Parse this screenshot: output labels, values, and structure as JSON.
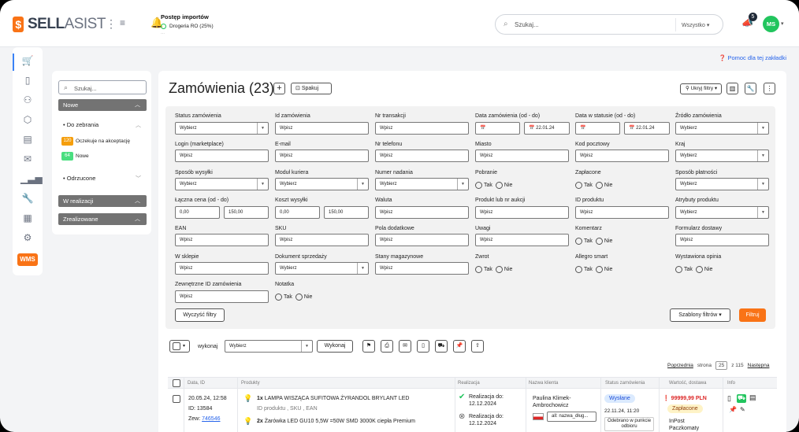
{
  "header": {
    "brand_bold": "SELL",
    "brand_light": "ASIST",
    "import_title": "Postęp importów",
    "import_row": "Drogeria RO (25%)",
    "import_row2": "...",
    "search_placeholder": "Szukaj...",
    "search_scope": "Wszystko",
    "notif_count": "5",
    "avatar_initials": "MS"
  },
  "help_link": "Pomoc dla tej zakładki",
  "sidebar": {
    "search_placeholder": "Szukaj...",
    "group_new": "Nowe",
    "sub_collect": "Do zebrania",
    "item1_count": "120",
    "item1_label": "Oczekuje na akceptację",
    "item2_count": "64",
    "item2_label": "Nowe",
    "sub_rejected": "Odrzucone",
    "group_inprogress": "W realizacji",
    "group_done": "Zrealizowane",
    "wms": "WMS"
  },
  "page": {
    "title": "Zamówienia (23)",
    "pack_label": "Spakuj",
    "hide_filters": "Ukryj filtry"
  },
  "filters": {
    "status": "Status zamówienia",
    "order_id": "Id zamówienia",
    "txn": "Nr transakcji",
    "order_date": "Data zamówienia (od - do)",
    "status_date": "Data w statusie (od - do)",
    "source": "Źródło zamówienia",
    "login": "Login (marketplace)",
    "email": "E-mail",
    "phone": "Nr telefonu",
    "city": "Miasto",
    "zip": "Kod pocztowy",
    "country": "Kraj",
    "ship_method": "Sposób wysyłki",
    "courier": "Moduł kuriera",
    "tracking": "Numer nadania",
    "cod": "Pobranie",
    "paid": "Zapłacone",
    "pay_method": "Sposób płatności",
    "total": "Łączna cena (od - do)",
    "ship_cost": "Koszt wysyłki",
    "currency": "Waluta",
    "product": "Produkt lub nr aukcji",
    "product_id": "ID produktu",
    "attr": "Atrybuty produktu",
    "ean": "EAN",
    "sku": "SKU",
    "extra": "Pola dodatkowe",
    "notes": "Uwagi",
    "comment": "Komentarz",
    "delivery_form": "Formularz dostawy",
    "in_store": "W sklepie",
    "sales_doc": "Dokument sprzedaży",
    "stock": "Stany magazynowe",
    "return": "Zwrot",
    "allegro": "Allegro smart",
    "review": "Wystawiona opinia",
    "ext_id": "Zewnętrzne ID zamówienia",
    "memo": "Notatka",
    "choose": "Wybierz",
    "enter": "Wpisz",
    "date_to": "22.01.24",
    "price_from": "0,00",
    "price_to": "150,00",
    "yes": "Tak",
    "no": "Nie",
    "clear": "Wyczyść filtry",
    "templates": "Szablony filtrów",
    "apply": "Filtruj"
  },
  "bulk": {
    "label": "wykonaj",
    "select": "Wybierz",
    "exec": "Wykonaj"
  },
  "pager": {
    "prev": "Poprzednia",
    "page_word": "strona",
    "page": "25",
    "of": "z 115",
    "next": "Następna"
  },
  "table": {
    "cols": [
      "Data, ID",
      "Produkty",
      "Realizacja",
      "Nazwa klienta",
      "Status zamówienia",
      "Wartość, dostawa",
      "Info"
    ],
    "row": {
      "date": "20.05.24, 12:58",
      "id": "ID: 13584",
      "zew_label": "Zew:",
      "zew_val": "746546",
      "p1_qty": "1x",
      "p1_name": "LAMPA WISZĄCA SUFITOWA ŻYRANDOL BRYLANT LED",
      "p1_meta": "ID produktu , SKU , EAN",
      "p2_qty": "2x",
      "p2_name": "Żarówka LED GU10 5,5W =50W SMD 3000K ciepła Premium",
      "real1_a": "Realizacja do:",
      "real1_b": "12.12.2024",
      "real2_a": "Realizacja do:",
      "real2_b": "12.12.2024",
      "client1": "Paulina Klimek-",
      "client2": "Ambrochowicz",
      "client_tag": "all: nazwa_dług...",
      "status": "Wysłane",
      "status_time": "22.11.24, 11:20",
      "status_tag1": "Odebrano w punkcie",
      "status_tag2": "odbioru",
      "value": "99999,99 PLN",
      "paid": "Zapłacone",
      "delivery1": "InPost",
      "delivery2": "Paczkomaty"
    }
  }
}
